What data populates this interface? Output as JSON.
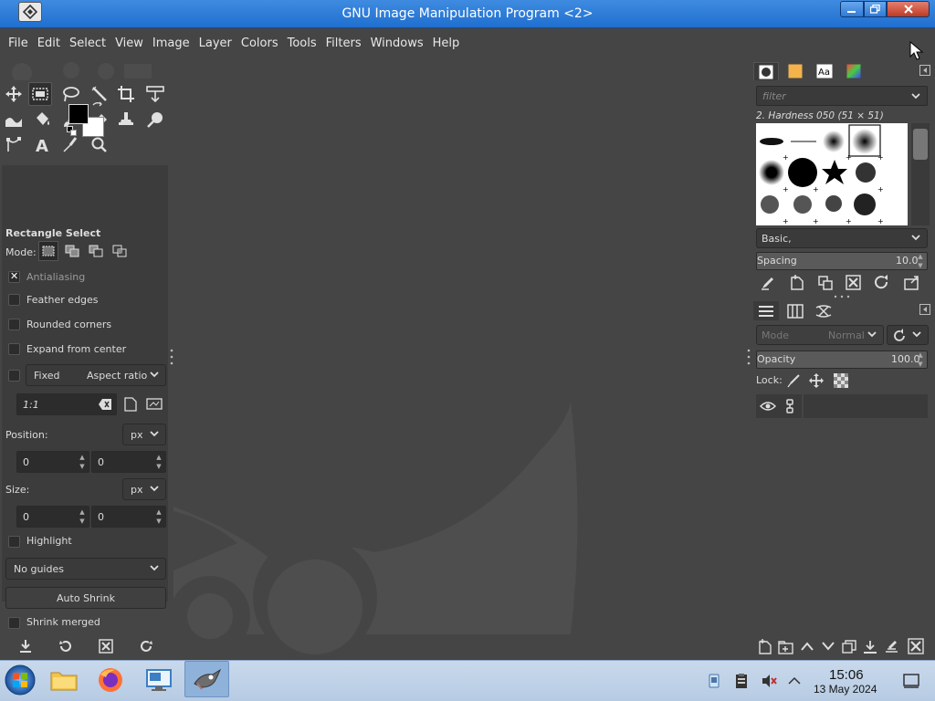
{
  "window": {
    "title": "GNU Image Manipulation Program <2>"
  },
  "menu": [
    "File",
    "Edit",
    "Select",
    "View",
    "Image",
    "Layer",
    "Colors",
    "Tools",
    "Filters",
    "Windows",
    "Help"
  ],
  "colors": {
    "foreground": "#000000",
    "background": "#ffffff",
    "ui_bg": "#454545",
    "panel_bg": "#3c3c3c",
    "titlebar": "#2f7bd6"
  },
  "tool_options": {
    "title": "Rectangle Select",
    "mode_label": "Mode:",
    "antialiasing": "Antialiasing",
    "feather_edges": "Feather edges",
    "rounded_corners": "Rounded corners",
    "expand_from_center": "Expand from center",
    "fixed": "Fixed",
    "fixed_option": "Aspect ratio",
    "ratio_value": "1:1",
    "position_label": "Position:",
    "position_unit": "px",
    "position_x": "0",
    "position_y": "0",
    "size_label": "Size:",
    "size_unit": "px",
    "size_w": "0",
    "size_h": "0",
    "highlight": "Highlight",
    "guides": "No guides",
    "auto_shrink": "Auto Shrink",
    "shrink_merged": "Shrink merged"
  },
  "brushes": {
    "filter_placeholder": "filter",
    "selected_brush": "2. Hardness 050 (51 × 51)",
    "tag": "Basic,",
    "spacing_label": "Spacing",
    "spacing_value": "10.0"
  },
  "layers": {
    "mode_label": "Mode",
    "mode_value": "Normal",
    "opacity_label": "Opacity",
    "opacity_value": "100.0",
    "lock_label": "Lock:"
  },
  "taskbar": {
    "time": "15:06",
    "date": "13 May 2024"
  }
}
